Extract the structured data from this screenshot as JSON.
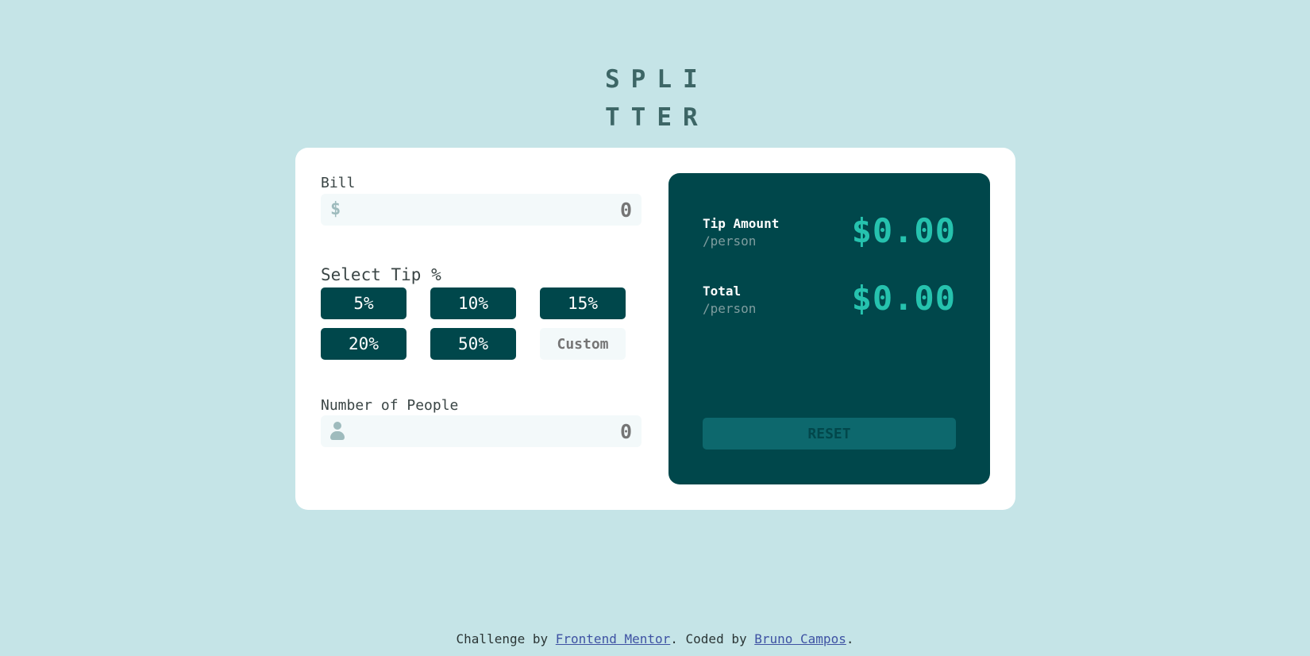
{
  "logo": {
    "line1": "SPLI",
    "line2": "TTER"
  },
  "bill": {
    "label": "Bill",
    "currency_symbol": "$",
    "placeholder": "0"
  },
  "tip": {
    "label": "Select Tip %",
    "options": [
      "5%",
      "10%",
      "15%",
      "20%",
      "50%"
    ],
    "custom_placeholder": "Custom"
  },
  "people": {
    "label": "Number of People",
    "placeholder": "0"
  },
  "results": {
    "tip_amount": {
      "label": "Tip Amount",
      "sub": "/person",
      "value": "$0.00"
    },
    "total": {
      "label": "Total",
      "sub": "/person",
      "value": "$0.00"
    },
    "reset_label": "RESET"
  },
  "footer": {
    "prefix": "Challenge by ",
    "link1": "Frontend Mentor",
    "middle": ". Coded by ",
    "link2": "Bruno Campos",
    "suffix": "."
  },
  "colors": {
    "background": "#c5e4e7",
    "primary": "#00474b",
    "accent": "#26c2ae",
    "input_bg": "#f3f9fa"
  }
}
